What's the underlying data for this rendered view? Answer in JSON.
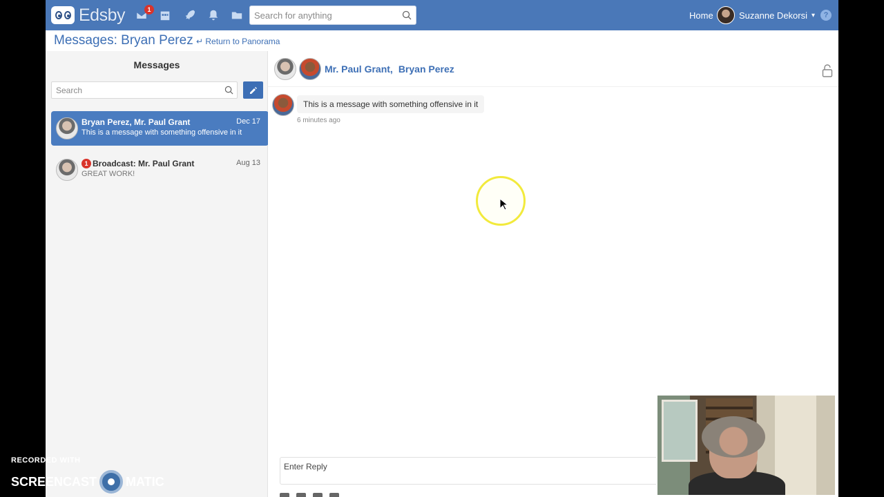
{
  "app": {
    "logo_text": "Edsby"
  },
  "topbar": {
    "mail_badge": "1",
    "search_placeholder": "Search for anything",
    "home_label": "Home",
    "user_name": "Suzanne Dekorsi",
    "help_label": "?"
  },
  "header": {
    "title": "Messages: Bryan Perez",
    "return_label": "↵ Return to Panorama"
  },
  "sidebar": {
    "title": "Messages",
    "search_placeholder": "Search",
    "conversations": [
      {
        "names": "Bryan Perez, Mr. Paul Grant",
        "date": "Dec 17",
        "preview": "This is a message with something offensive in it",
        "active": true
      },
      {
        "unread": "1",
        "names": "Broadcast: Mr. Paul Grant",
        "date": "Aug 13",
        "preview": "GREAT WORK!",
        "active": false
      }
    ]
  },
  "thread": {
    "participants": [
      "Mr. Paul Grant",
      "Bryan Perez"
    ],
    "separator": ",",
    "messages": [
      {
        "text": "This is a message with something offensive in it",
        "time": "6 minutes ago"
      }
    ],
    "reply_placeholder": "Enter Reply"
  },
  "overlay": {
    "recorded_with": "RECORDED WITH",
    "brand_left": "SCREENCAST",
    "brand_right": "MATIC"
  },
  "colors": {
    "topbar": "#4a78b8",
    "accent": "#3d6fb5",
    "active_conversation": "#4a7cc0",
    "badge": "#d9342b"
  }
}
